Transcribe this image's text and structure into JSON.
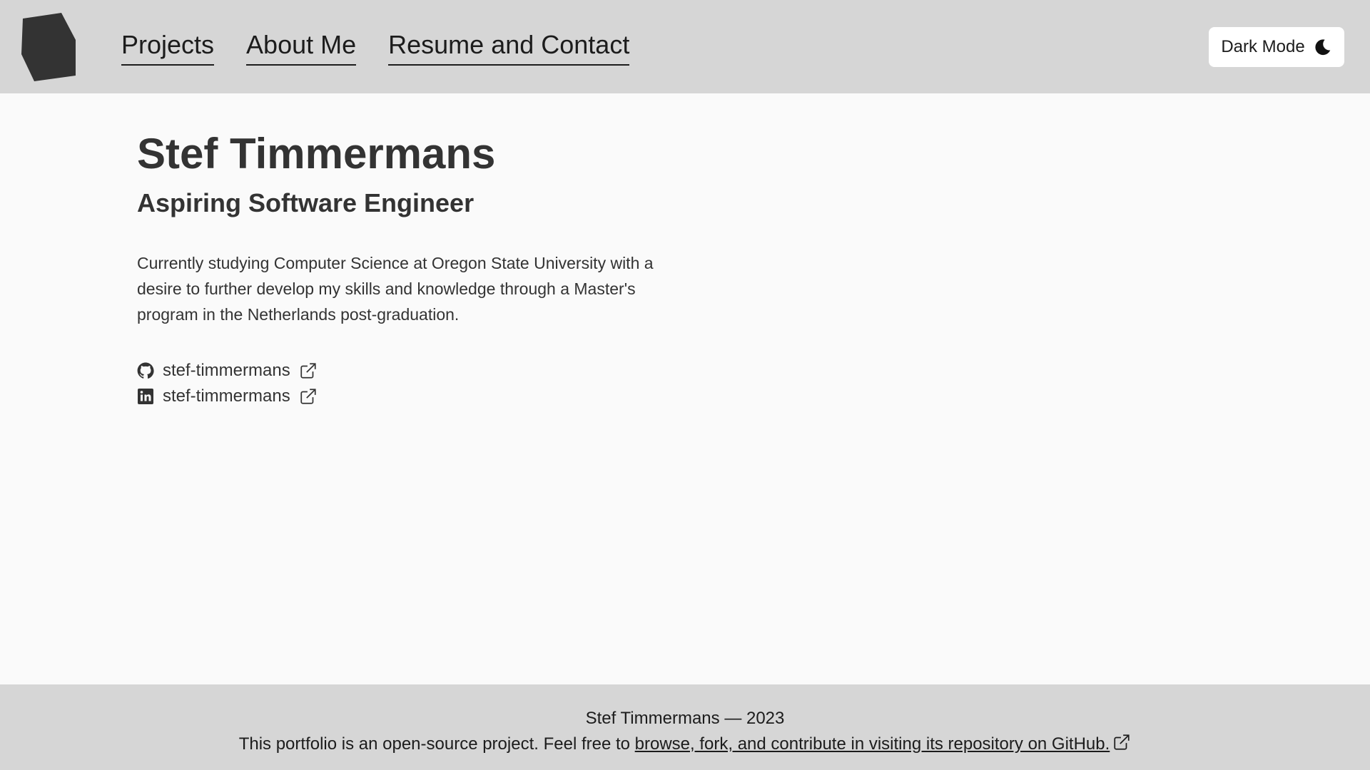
{
  "header": {
    "logo_icon": "cube-logo-icon",
    "nav": [
      {
        "label": "Projects"
      },
      {
        "label": "About Me"
      },
      {
        "label": "Resume and Contact"
      }
    ],
    "mode_toggle": {
      "label": "Dark Mode",
      "icon": "moon-icon"
    }
  },
  "main": {
    "name": "Stef Timmermans",
    "role": "Aspiring Software Engineer",
    "bio": "Currently studying Computer Science at Oregon State University with a desire to further develop my skills and knowledge through a Master's program in the Netherlands post-graduation.",
    "links": [
      {
        "icon": "github-icon",
        "label": "stef-timmermans",
        "trailing_icon": "external-link-icon"
      },
      {
        "icon": "linkedin-icon",
        "label": "stef-timmermans",
        "trailing_icon": "external-link-icon"
      }
    ]
  },
  "footer": {
    "copyright": "Stef Timmermans — 2023",
    "note_prefix": "This portfolio is an open-source project. Feel free to ",
    "repo_link": "browse, fork, and contribute in visiting its repository on GitHub."
  },
  "colors": {
    "header_bg": "#d6d6d6",
    "page_bg": "#fafafa",
    "text": "#333333",
    "logo": "#333333"
  }
}
